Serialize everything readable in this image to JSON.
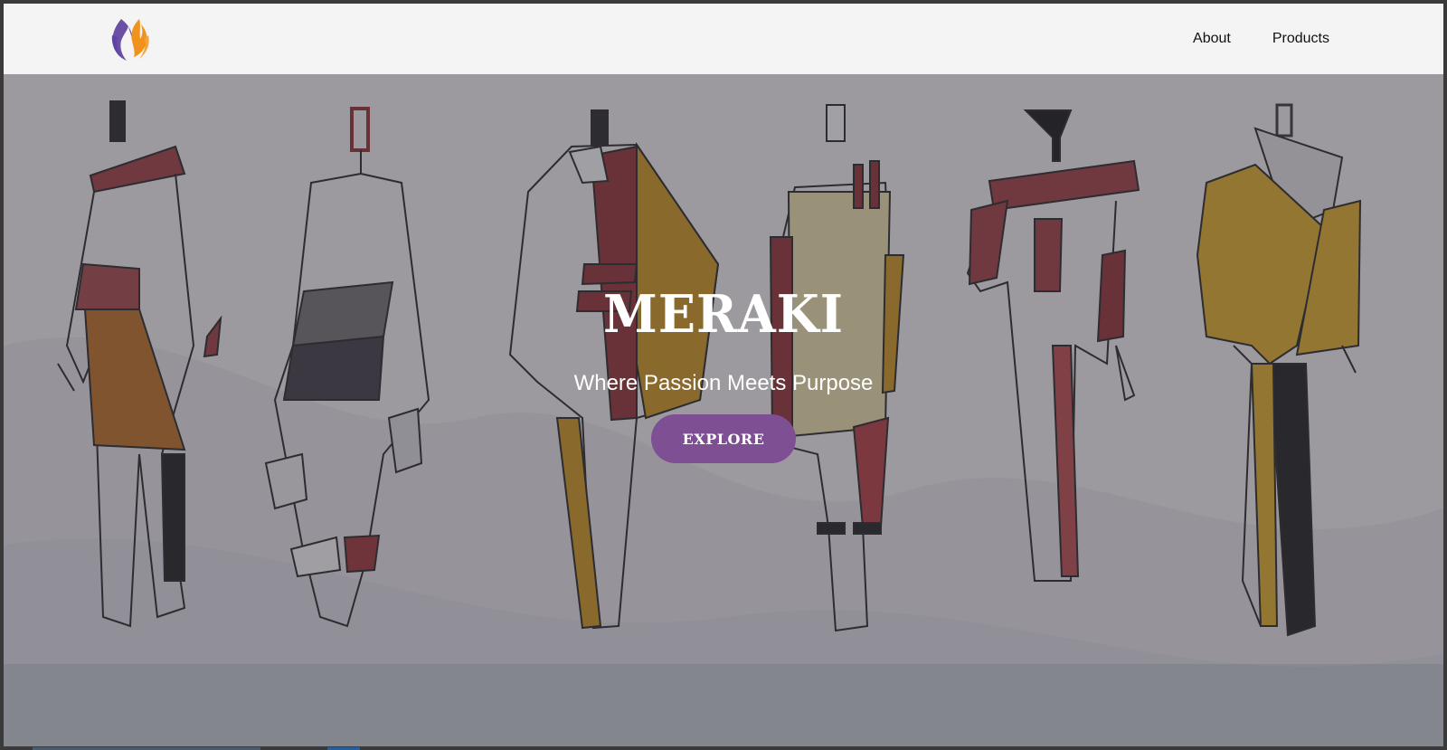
{
  "navbar": {
    "logo_icon": "meraki-flame-logo",
    "links": [
      {
        "label": "About"
      },
      {
        "label": "Products"
      }
    ]
  },
  "hero": {
    "brand": "MERAKI",
    "tagline": "Where Passion Meets Purpose",
    "cta_label": "EXPLORE",
    "background_image": "fashion-sketch-figures-illustration"
  },
  "colors": {
    "accent": "#7e4f93",
    "logo_purple": "#6b4fa6",
    "logo_orange": "#f0921e",
    "navbar_bg": "#f4f4f4"
  }
}
